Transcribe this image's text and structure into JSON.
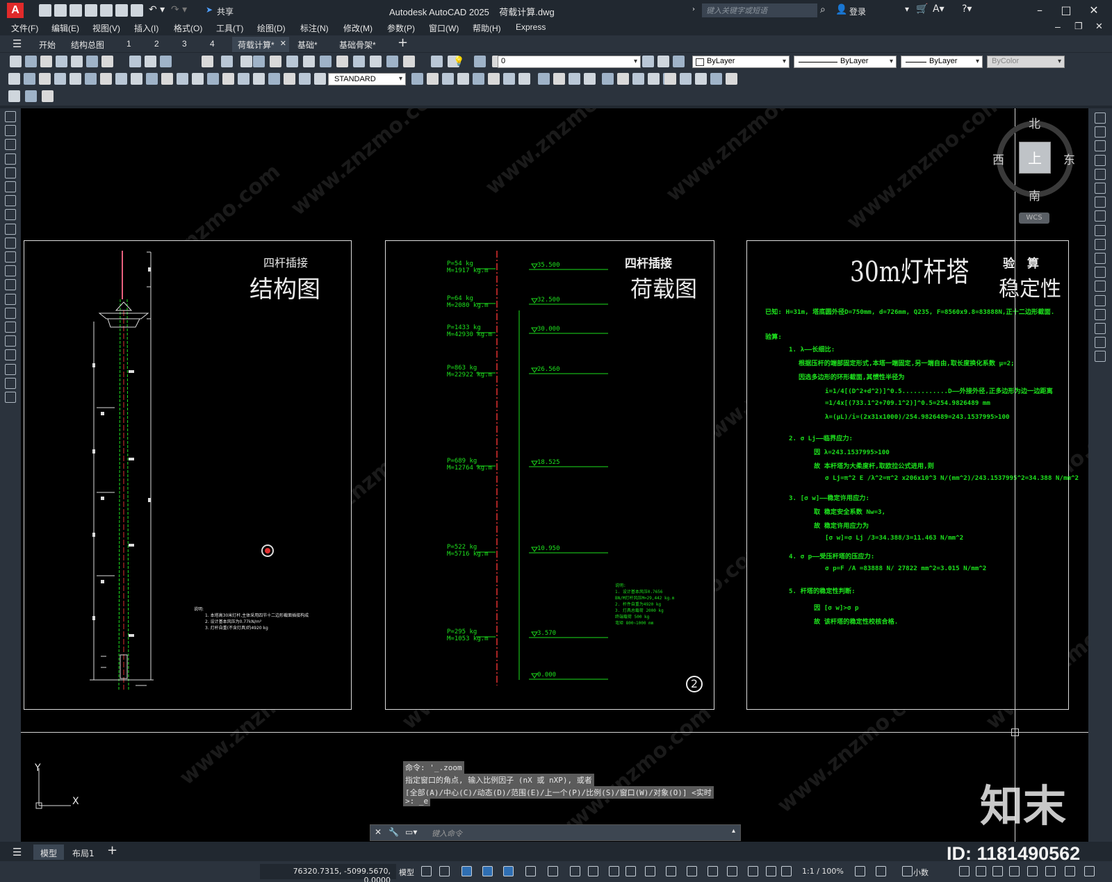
{
  "app": {
    "title": "Autodesk AutoCAD 2025",
    "filename": "荷载计算.dwg",
    "logo_letter": "A",
    "share": "共享",
    "search_placeholder": "键入关键字或短语",
    "login": "登录"
  },
  "menu": [
    "文件(F)",
    "编辑(E)",
    "视图(V)",
    "插入(I)",
    "格式(O)",
    "工具(T)",
    "绘图(D)",
    "标注(N)",
    "修改(M)",
    "参数(P)",
    "窗口(W)",
    "帮助(H)",
    "Express"
  ],
  "tabs": [
    "开始",
    "结构总图",
    "1",
    "2",
    "3",
    "4",
    "荷载计算*",
    "基础*",
    "基础骨架*"
  ],
  "toolbar": {
    "layer_value": "0",
    "text_style": "STANDARD",
    "color": "ByLayer",
    "linetype": "ByLayer",
    "lineweight": "ByLayer",
    "plotstyle": "ByColor"
  },
  "viewcube": {
    "north": "北",
    "south": "南",
    "east": "东",
    "west": "西",
    "top": "上",
    "wcs": "WCS"
  },
  "sheet1": {
    "title_small": "四杆插接",
    "title_big": "结构图",
    "notes": [
      "说明:",
      "1. 本塔高30米灯杆,主体采用四节十二边形截面插接构成",
      "2. 设计基本风压为0.77kN/m²",
      "3. 灯杆自重(不含灯具)约4920 kg"
    ]
  },
  "sheet2": {
    "title_small": "四杆插接",
    "title_big": "荷载图",
    "number": "2",
    "elevs": [
      "35.500",
      "32.500",
      "30.000",
      "26.560",
      "18.525",
      "10.950",
      "3.570",
      "0.000"
    ],
    "loads": [
      "P=54 kg",
      "M=1917 kg.m",
      "P=64 kg",
      "M=2080 kg.m",
      "P=1433 kg",
      "M=42930 kg.m",
      "P=863 kg",
      "M=22922 kg.m",
      "P=689 kg",
      "M=12764 kg.m",
      "P=522 kg",
      "M=5716 kg.m",
      "P=295 kg",
      "M=1053 kg.m"
    ],
    "notes": [
      "说明:",
      "1. 设计基本风压0.7656",
      "BN/M灯杆风压M=29,442 kg.m",
      "2. 杆件自重为4920 kg",
      "3. 灯具总载荷 2000 kg",
      "终端载荷 500 kg",
      "弯矩 800~1000 mm"
    ]
  },
  "sheet3": {
    "title": "30m灯杆塔",
    "title_right_small": "验 算",
    "title_right_big": "稳定性",
    "lines": [
      "已知: H=31m, 塔底圆外径D=750mm, d=726mm, Q235, F=8560x9.8=83888N,正十二边形截面.",
      "验算:",
      "1. λ——长细比:",
      "根据压杆的端部固定形式,本塔一端固定,另一端自由,取长度换化系数 μ=2;",
      "因选多边形的环形截面,其惯性半径为",
      "i=1/4[(D^2+d^2)]^0.5............D——外接外径,正多边形为边一边距离",
      "=1/4x[(733.1^2+709.1^2)]^0.5=254.9826489 mm",
      "λ=(μL)/i=(2x31x1000)/254.9826489=243.1537995>100",
      "2. σ Lj——临界应力:",
      "因 λ=243.1537995>100",
      "故 本杆塔为大柔度杆,取欧拉公式进用,则",
      "σ Lj=π^2 E /λ^2=π^2 x206x10^3 N/(mm^2)/243.1537995^2=34.388 N/mm^2",
      "3. [σ w]——稳定许用应力:",
      "取 稳定安全系数 Nw=3,",
      "故 稳定许用应力为",
      "[σ w]=σ Lj /3=34.388/3=11.463 N/mm^2",
      "4. σ p——受压杆塔的压应力:",
      "σ p=F /A =83888 N/ 27822 mm^2=3.015 N/mm^2",
      "5. 杆塔的稳定性判断:",
      "因 [σ w]>σ p",
      "故 该杆塔的稳定性校核合格."
    ]
  },
  "command": {
    "history": [
      "命令: '_.zoom",
      "指定窗口的角点, 输入比例因子 (nX 或 nXP), 或者",
      "[全部(A)/中心(C)/动态(D)/范围(E)/上一个(P)/比例(S)/窗口(W)/对象(O)] <实时",
      ">: _e"
    ],
    "placeholder": "键入命令"
  },
  "ucs": {
    "x": "X",
    "y": "Y"
  },
  "watermark": {
    "brand": "知末",
    "id": "ID: 1181490562",
    "url": "www.znzmo.com"
  },
  "layouts": [
    "模型",
    "布局1"
  ],
  "status": {
    "coords": "76320.7315, -5099.5670, 0.0000",
    "space": "模型",
    "scale": "1:1 / 100%",
    "units": "小数"
  }
}
